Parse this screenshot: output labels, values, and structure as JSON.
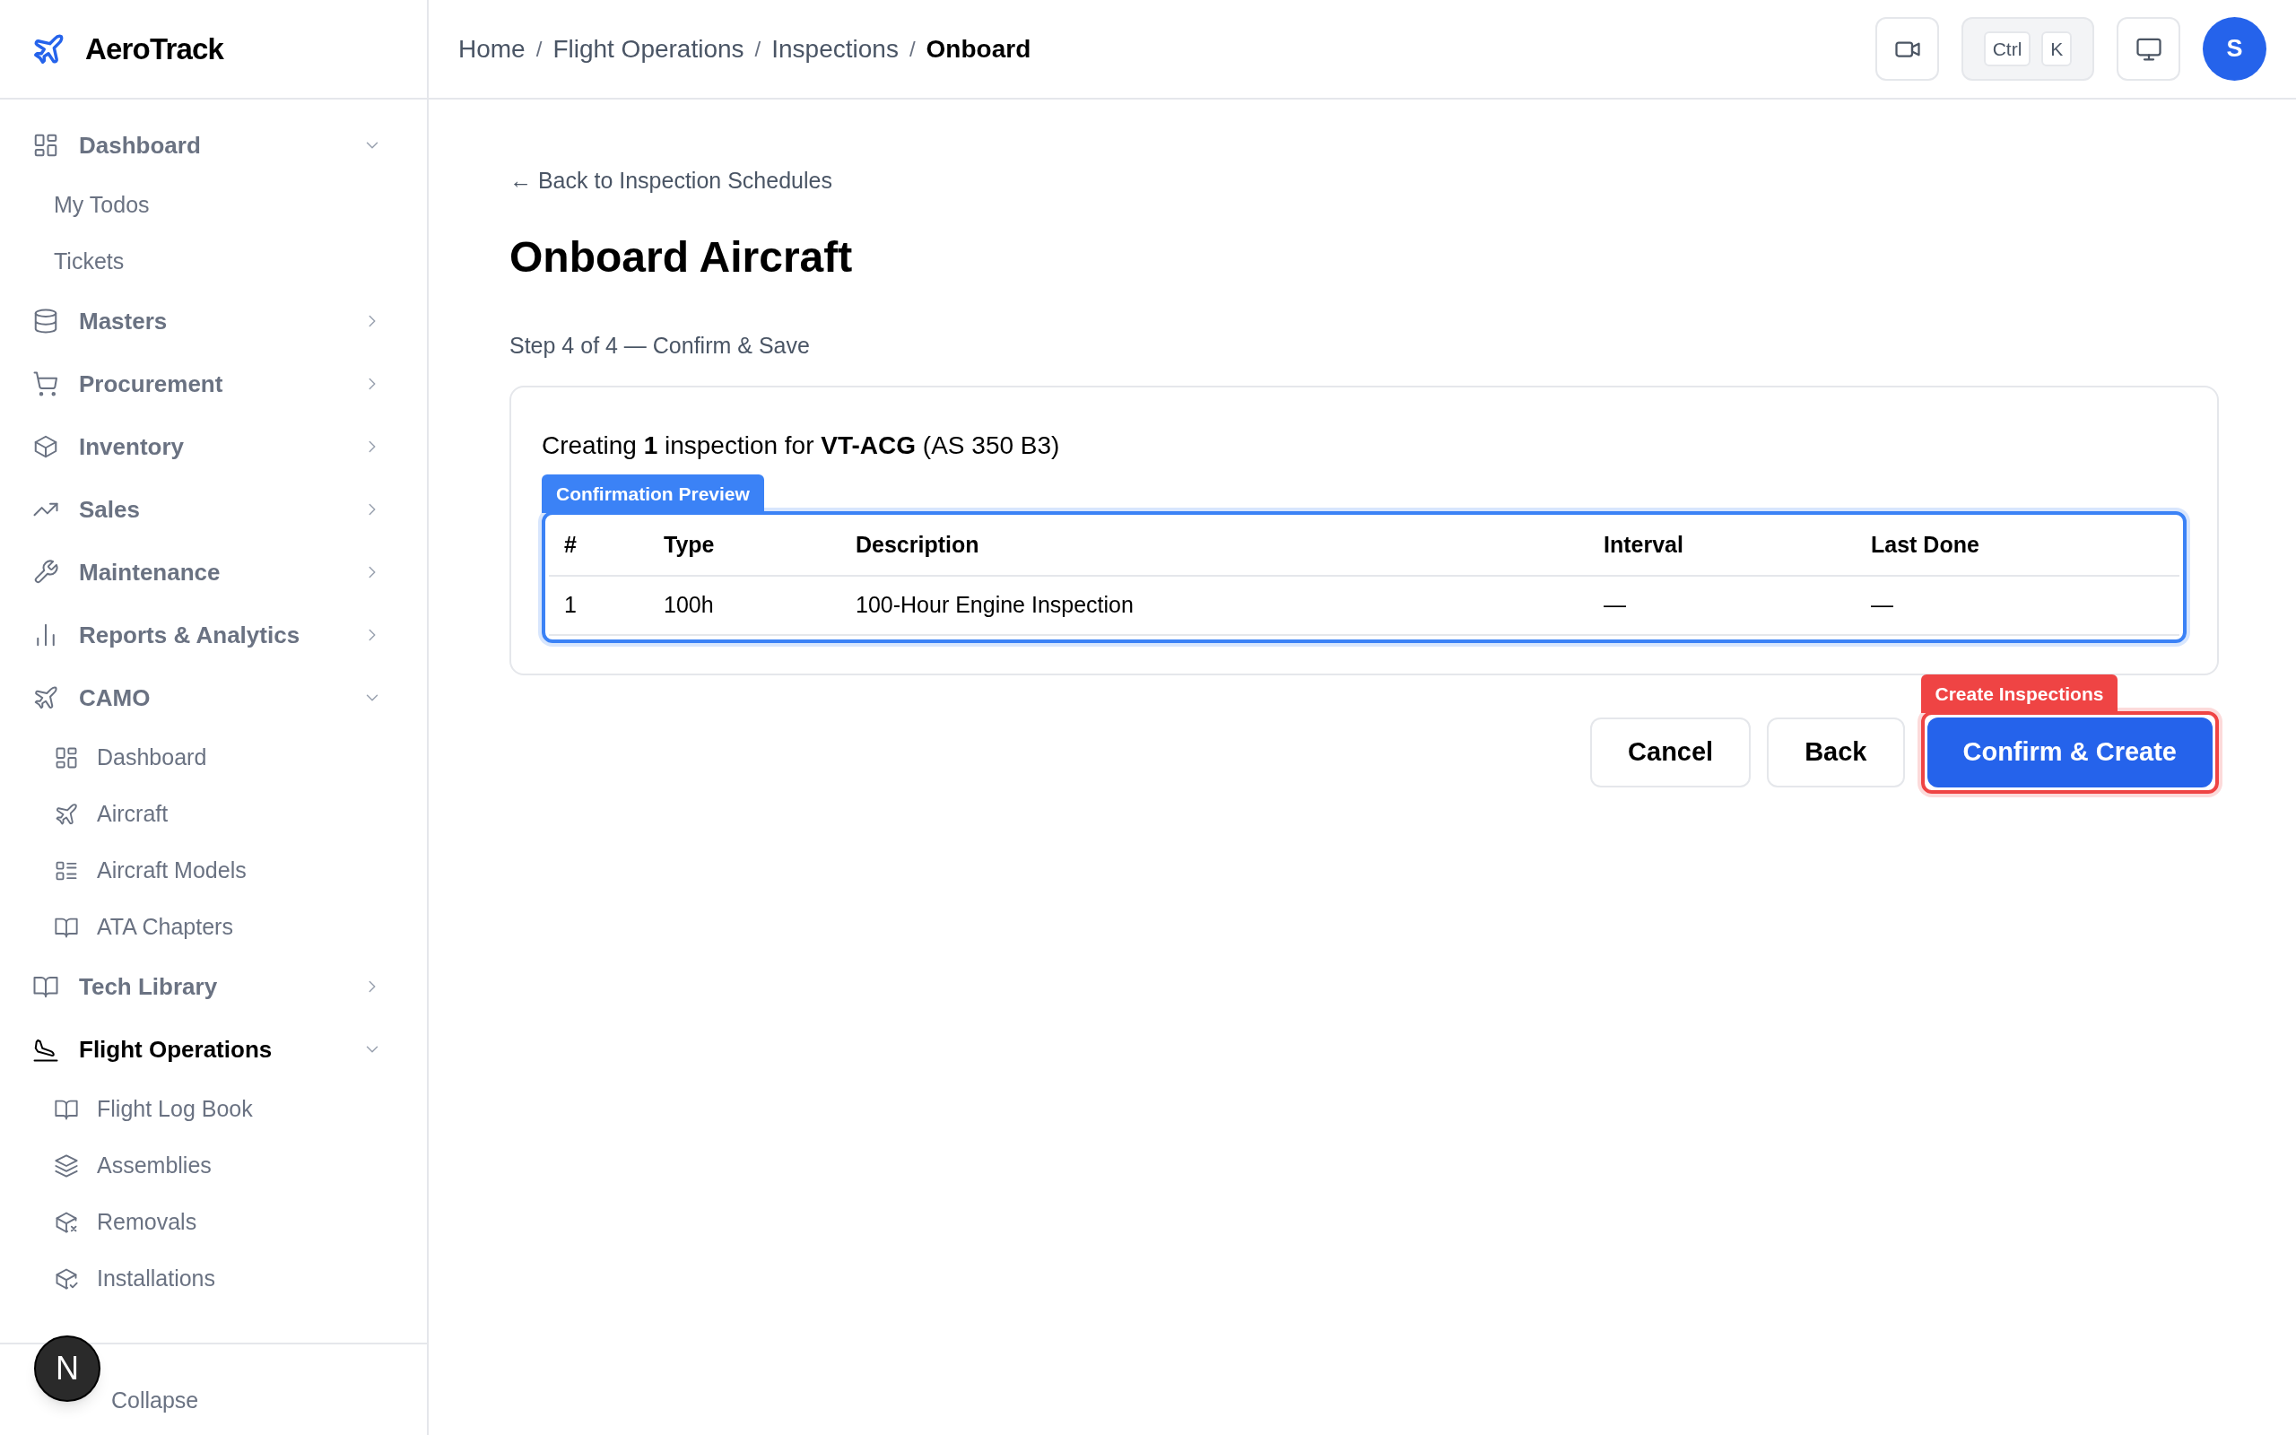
{
  "brand": {
    "name": "AeroTrack"
  },
  "sidebar": {
    "items": [
      {
        "label": "Dashboard",
        "expanded": true,
        "active": false,
        "children": [
          {
            "label": "My Todos"
          },
          {
            "label": "Tickets"
          }
        ]
      },
      {
        "label": "Masters",
        "expanded": false,
        "active": false
      },
      {
        "label": "Procurement",
        "expanded": false,
        "active": false
      },
      {
        "label": "Inventory",
        "expanded": false,
        "active": false
      },
      {
        "label": "Sales",
        "expanded": false,
        "active": false
      },
      {
        "label": "Maintenance",
        "expanded": false,
        "active": false
      },
      {
        "label": "Reports & Analytics",
        "expanded": false,
        "active": false
      },
      {
        "label": "CAMO",
        "expanded": true,
        "active": false,
        "children": [
          {
            "label": "Dashboard"
          },
          {
            "label": "Aircraft"
          },
          {
            "label": "Aircraft Models"
          },
          {
            "label": "ATA Chapters"
          }
        ]
      },
      {
        "label": "Tech Library",
        "expanded": false,
        "active": false
      },
      {
        "label": "Flight Operations",
        "expanded": true,
        "active": true,
        "children": [
          {
            "label": "Flight Log Book"
          },
          {
            "label": "Assemblies"
          },
          {
            "label": "Removals"
          },
          {
            "label": "Installations"
          }
        ]
      }
    ],
    "collapse_label": "Collapse"
  },
  "dev_badge": {
    "label": "N"
  },
  "breadcrumb": [
    {
      "label": "Home",
      "current": false
    },
    {
      "label": "Flight Operations",
      "current": false
    },
    {
      "label": "Inspections",
      "current": false
    },
    {
      "label": "Onboard",
      "current": true
    }
  ],
  "breadcrumb_separator": "/",
  "shortcut": {
    "keys": [
      "Ctrl",
      "K"
    ]
  },
  "avatar": {
    "initial": "S"
  },
  "back_link": "← Back to Inspection Schedules",
  "title": "Onboard Aircraft",
  "step": "Step 4 of 4 — Confirm & Save",
  "summary": "Creating **1** inspection for **VT-ACG** (AS 350 B3)",
  "table": {
    "annotation": {
      "label": "Confirmation Preview",
      "color": "#3b82f6"
    },
    "columns": [
      "#",
      "Type",
      "Description",
      "Interval",
      "Last Done"
    ],
    "rows": [
      [
        "1",
        "100h",
        "100-Hour Engine Inspection",
        "—",
        "—"
      ]
    ]
  },
  "buttons": [
    {
      "label": "Cancel",
      "kind": "secondary"
    },
    {
      "label": "Back",
      "kind": "secondary"
    },
    {
      "label": "Confirm & Create",
      "kind": "primary",
      "annotation": {
        "label": "Create Inspections",
        "color": "#ef4444"
      }
    }
  ]
}
